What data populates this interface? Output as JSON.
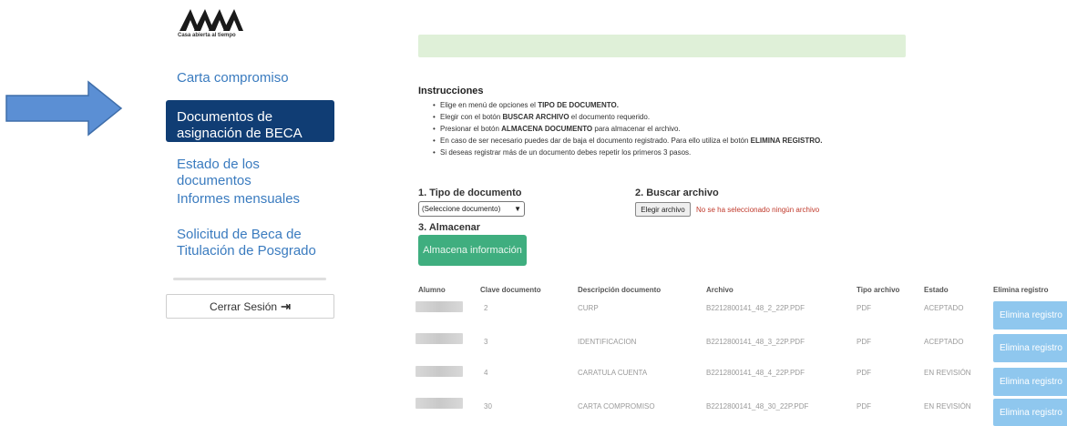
{
  "logo": {
    "tagline": "Casa abierta al tiempo"
  },
  "sidebar": {
    "items": [
      {
        "label": "Carta compromiso"
      },
      {
        "label": "Documentos de asignación de BECA"
      },
      {
        "label": "Estado de los documentos"
      },
      {
        "label": "Informes mensuales"
      },
      {
        "label": "Solicitud de Beca de Titulación de Posgrado"
      }
    ],
    "logout_label": "Cerrar Sesión"
  },
  "instructions": {
    "title": "Instrucciones",
    "items": [
      {
        "pre": "Elige en menú de opciones el ",
        "bold": "TIPO DE DOCUMENTO.",
        "post": ""
      },
      {
        "pre": "Elegir con el botón ",
        "bold": "BUSCAR ARCHIVO",
        "post": " el documento requerido."
      },
      {
        "pre": "Presionar el botón ",
        "bold": "ALMACENA DOCUMENTO",
        "post": " para almacenar el archivo."
      },
      {
        "pre": "En caso de ser necesario puedes dar de baja el documento registrado. Para ello utiliza el botón ",
        "bold": "ELIMINA REGISTRO.",
        "post": ""
      },
      {
        "pre": "Si deseas registrar más de un documento debes repetir los primeros 3 pasos.",
        "bold": "",
        "post": ""
      }
    ]
  },
  "form": {
    "step1_label": "1. Tipo de documento",
    "select_value": "(Seleccione documento)",
    "step2_label": "2. Buscar archivo",
    "file_button": "Elegir archivo",
    "no_file_text": "No se ha seleccionado ningún archivo",
    "step3_label": "3. Almacenar",
    "store_button": "Almacena información"
  },
  "table": {
    "headers": [
      "Alumno",
      "Clave documento",
      "Descripción documento",
      "Archivo",
      "Tipo archivo",
      "Estado",
      "Elimina registro"
    ],
    "rows": [
      {
        "clave": "2",
        "descripcion": "CURP",
        "archivo": "B2212800141_48_2_22P.PDF",
        "tipo": "PDF",
        "estado": "ACEPTADO",
        "accion": "Elimina registro"
      },
      {
        "clave": "3",
        "descripcion": "IDENTIFICACION",
        "archivo": "B2212800141_48_3_22P.PDF",
        "tipo": "PDF",
        "estado": "ACEPTADO",
        "accion": "Elimina registro"
      },
      {
        "clave": "4",
        "descripcion": "CARATULA CUENTA",
        "archivo": "B2212800141_48_4_22P.PDF",
        "tipo": "PDF",
        "estado": "EN REVISIÓN",
        "accion": "Elimina registro"
      },
      {
        "clave": "30",
        "descripcion": "CARTA COMPROMISO",
        "archivo": "B2212800141_48_30_22P.PDF",
        "tipo": "PDF",
        "estado": "EN REVISIÓN",
        "accion": "Elimina registro"
      }
    ]
  },
  "colors": {
    "active_nav_bg": "#103d74",
    "nav_link": "#3a7bbf",
    "success_bar": "#dff0d8",
    "store_button": "#3fae7f",
    "delete_button": "#8fc7ee",
    "arrow_fill": "#5b8fd4"
  }
}
